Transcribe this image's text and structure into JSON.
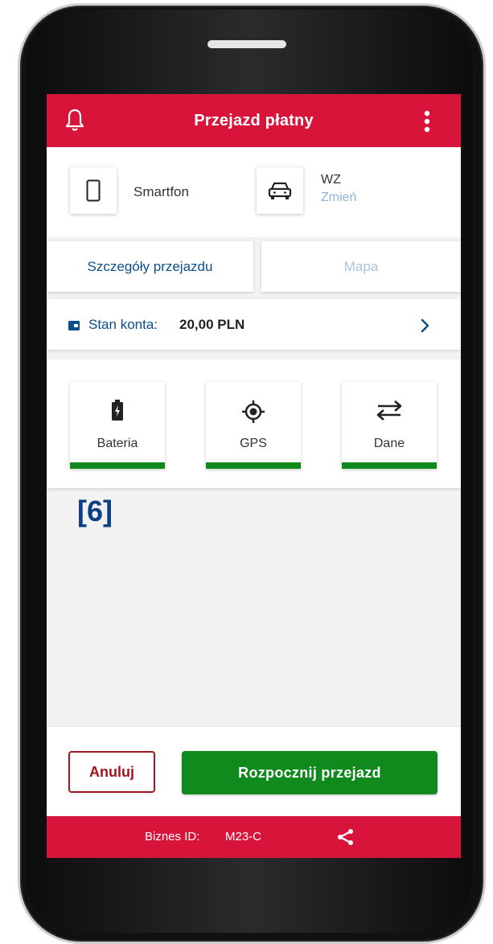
{
  "app_bar": {
    "title": "Przejazd płatny",
    "left_icon": "bell-icon",
    "right_icon": "more-vertical-icon"
  },
  "device": {
    "icon": "smartphone-icon",
    "label": "Smartfon"
  },
  "vehicle": {
    "icon": "car-icon",
    "code": "WZ",
    "change_label": "Zmień"
  },
  "tabs": [
    {
      "label": "Szczegóły przejazdu",
      "active": true
    },
    {
      "label": "Mapa",
      "active": false
    }
  ],
  "balance": {
    "icon": "wallet-icon",
    "label": "Stan konta:",
    "value": "20,00 PLN"
  },
  "status_items": [
    {
      "label": "Bateria",
      "icon": "battery-charging-icon",
      "status": "ok"
    },
    {
      "label": "GPS",
      "icon": "gps-target-icon",
      "status": "ok"
    },
    {
      "label": "Dane",
      "icon": "data-transfer-icon",
      "status": "ok"
    }
  ],
  "annotation": "[6]",
  "actions": {
    "cancel_label": "Anuluj",
    "start_label": "Rozpocznij przejazd"
  },
  "footer": {
    "business_id_label": "Biznes ID:",
    "business_id_value": "M23-C",
    "share_icon": "share-icon"
  },
  "colors": {
    "brand_red": "#d9143a",
    "primary_blue": "#0b4f8a",
    "link_light_blue": "#8fb4d8",
    "success_green": "#118a1d",
    "cancel_red": "#a3141c"
  }
}
